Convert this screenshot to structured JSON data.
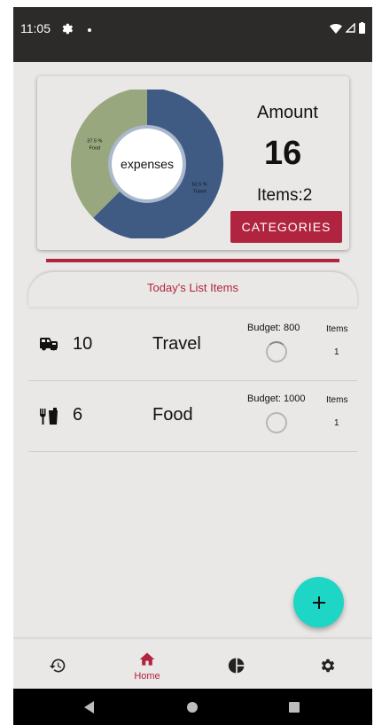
{
  "status_bar": {
    "time": "11:05",
    "icons": [
      "gear-icon",
      "notification-dot-icon",
      "wifi-icon",
      "signal-icon",
      "battery-icon"
    ]
  },
  "summary": {
    "donut_center_label": "expenses",
    "amount_label": "Amount",
    "amount_value": "16",
    "items_label": "Items:2",
    "categories_button": "CATEGORIES"
  },
  "chart_data": {
    "type": "pie",
    "categories": [
      "Travel",
      "Food"
    ],
    "values": [
      62.5,
      37.5
    ],
    "slice_labels": [
      "62.5 %\nTravel",
      "37.5 %\nFood"
    ],
    "center_label": "expenses",
    "colors": {
      "Travel": "#3f5b84",
      "Food": "#98a77e"
    }
  },
  "list": {
    "header": "Today's List Items",
    "rows": [
      {
        "icon": "car-icon",
        "count": "10",
        "name": "Travel",
        "budget": "Budget: 800",
        "items_label": "Items",
        "items_value": "1",
        "progress": 0.02
      },
      {
        "icon": "utensils-icon",
        "count": "6",
        "name": "Food",
        "budget": "Budget: 1000",
        "items_label": "Items",
        "items_value": "1",
        "progress": 0.0
      }
    ]
  },
  "fab": {
    "icon": "plus-icon"
  },
  "bottom_nav": {
    "items": [
      {
        "icon": "history-icon",
        "label": ""
      },
      {
        "icon": "home-icon",
        "label": "Home",
        "active": true
      },
      {
        "icon": "pie-chart-icon",
        "label": ""
      },
      {
        "icon": "settings-icon",
        "label": ""
      }
    ]
  },
  "colors": {
    "accent": "#b1243f",
    "fab": "#1ed6c5",
    "background": "#eae8e6"
  }
}
